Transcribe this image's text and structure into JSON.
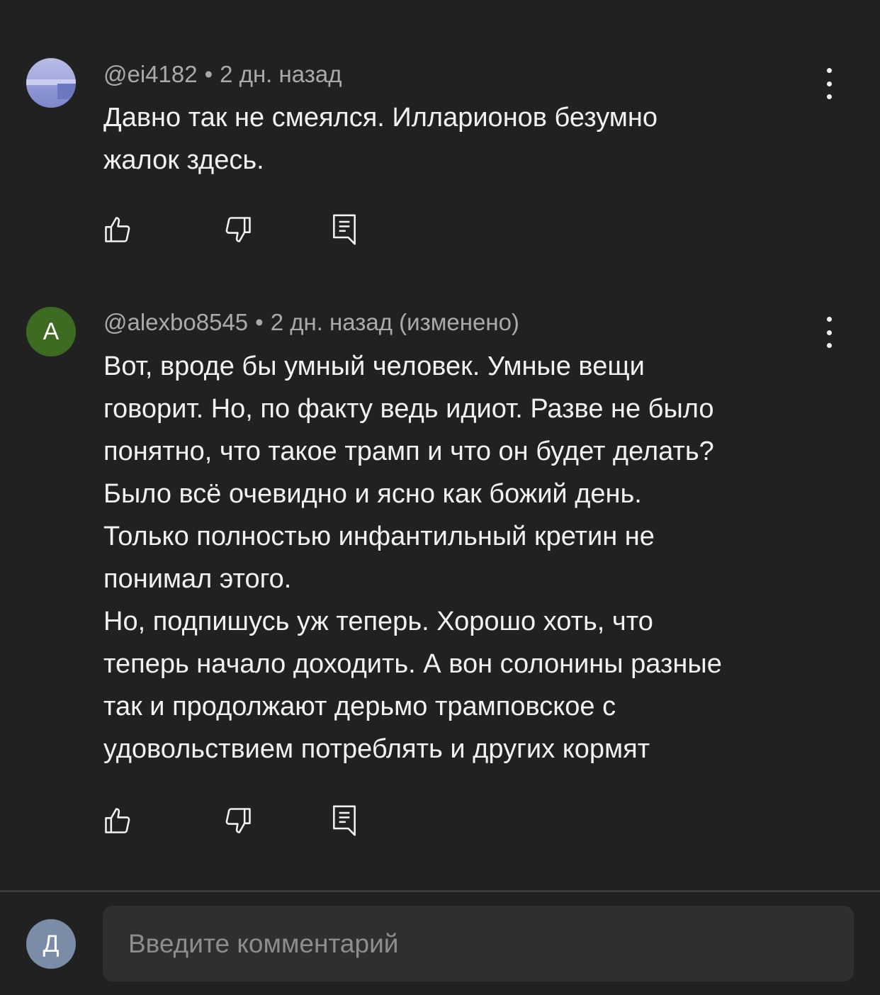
{
  "comments": [
    {
      "author": "@ei4182",
      "separator": "•",
      "time": "2 дн. назад",
      "text": "Давно так не смеялся. Илларионов безумно\nжалок здесь.",
      "avatar_letter": "",
      "icons": [
        "like-icon",
        "dislike-icon",
        "reply-icon",
        "more-vert-icon"
      ]
    },
    {
      "author": "@alexbo8545",
      "separator": "•",
      "time": "2 дн. назад (изменено)",
      "text": "Вот, вроде бы умный человек. Умные вещи\nговорит. Но, по факту ведь идиот. Разве не было\nпонятно, что такое трамп и что он будет делать?\nБыло всё очевидно и ясно как божий день.\nТолько полностью инфантильный кретин не\nпонимал этого.\nНо, подпишусь уж теперь. Хорошо хоть, что\nтеперь начало доходить. А вон солонины разные\nтак и продолжают дерьмо трамповское с\nудовольствием потреблять и других кормят",
      "avatar_letter": "A",
      "avatar_color": "#3e6b22",
      "icons": [
        "like-icon",
        "dislike-icon",
        "reply-icon",
        "more-vert-icon"
      ]
    }
  ],
  "composer": {
    "avatar_letter": "Д",
    "avatar_color": "#7b8ca6",
    "placeholder": "Введите комментарий"
  }
}
